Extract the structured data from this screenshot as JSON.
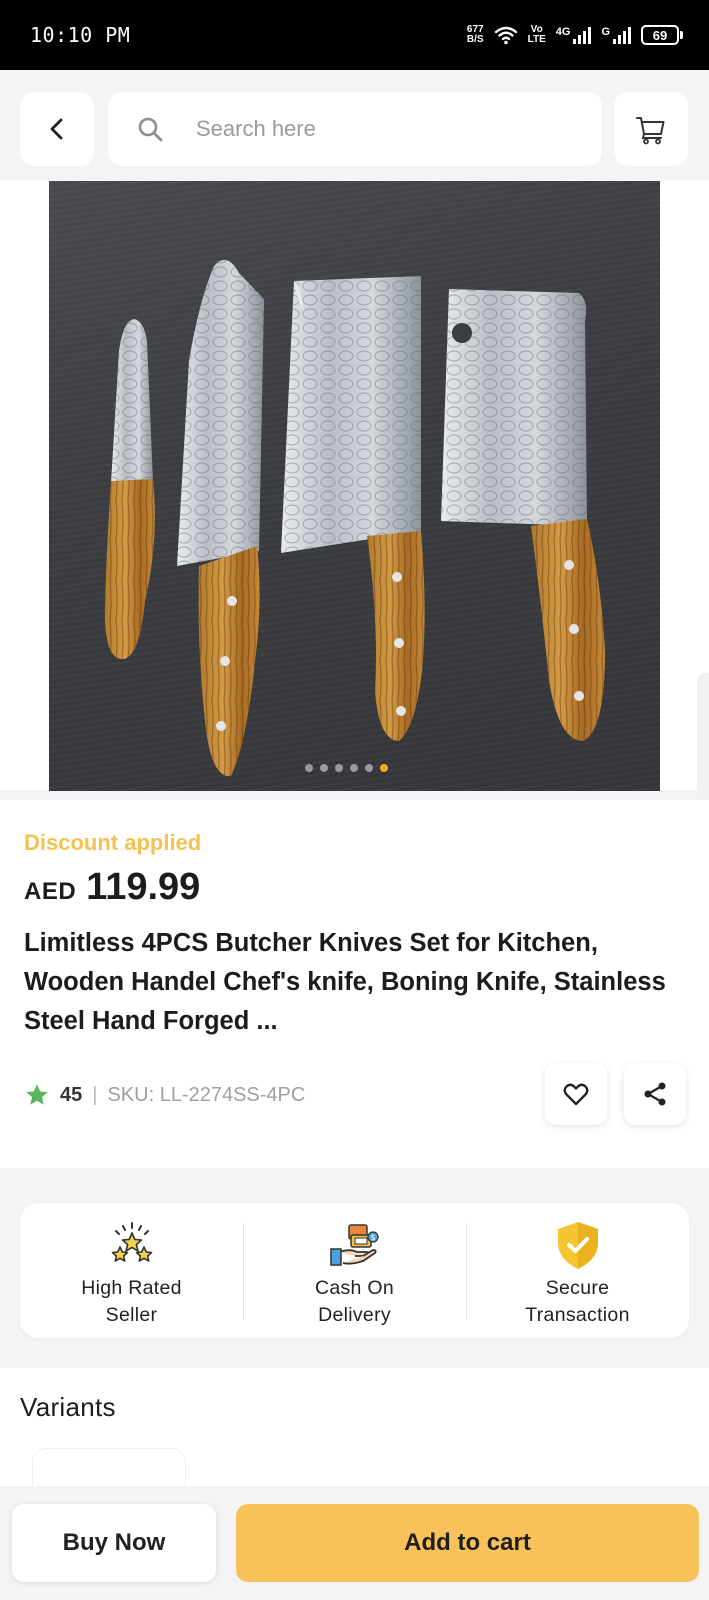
{
  "status_bar": {
    "time": "10:10 PM",
    "net_speed_value": "677",
    "net_speed_unit": "B/S",
    "volte_top": "Vo",
    "volte_bottom": "LTE",
    "sim1_label": "4G",
    "sim2_label": "G",
    "battery": "69"
  },
  "header": {
    "search_placeholder": "Search here",
    "back_icon": "chevron-left-icon",
    "search_icon": "search-icon",
    "cart_icon": "cart-icon"
  },
  "gallery": {
    "image_count": 6,
    "active_index": 5
  },
  "product": {
    "discount_label": "Discount applied",
    "currency": "AED",
    "price": "119.99",
    "title": "Limitless 4PCS Butcher Knives Set for Kitchen, Wooden Handel Chef's knife, Boning Knife, Stainless Steel Hand Forged ...",
    "rating": "45",
    "separator": "|",
    "sku": "SKU: LL-2274SS-4PC"
  },
  "features": [
    {
      "label": "High Rated\nSeller",
      "icon": "stars-icon"
    },
    {
      "label": "Cash On\nDelivery",
      "icon": "cash-delivery-icon"
    },
    {
      "label": "Secure\nTransaction",
      "icon": "shield-check-icon"
    }
  ],
  "variants": {
    "heading": "Variants"
  },
  "actions": {
    "buy_now": "Buy Now",
    "add_to_cart": "Add to cart"
  },
  "colors": {
    "accent": "#f9c15a",
    "discount": "#f6c150",
    "rating_star": "#5bb55a",
    "active_dot": "#f5a623"
  }
}
